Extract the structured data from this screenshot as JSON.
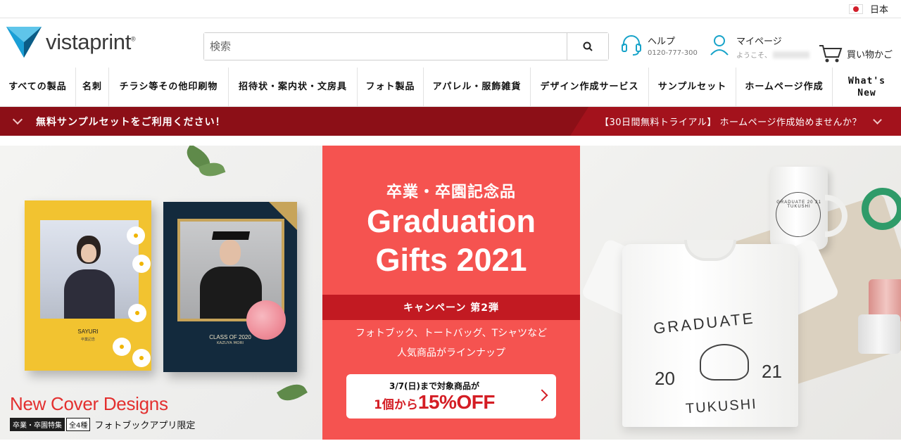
{
  "topbar": {
    "region": "日本"
  },
  "header": {
    "logo_text": "vistaprint",
    "logo_mark": "®",
    "search_placeholder": "検索",
    "help_label": "ヘルプ",
    "help_phone": "0120-777-300",
    "account_label": "マイページ",
    "account_greeting": "ようこそ、",
    "cart_label": "買い物かご"
  },
  "nav": {
    "items": [
      "すべての製品",
      "名刺",
      "チラシ等その他印刷物",
      "招待状・案内状・文房具",
      "フォト製品",
      "アパレル・服飾雑貨",
      "デザイン作成サービス",
      "サンプルセット",
      "ホームページ作成",
      "What's New"
    ]
  },
  "promo": {
    "left_text": "無料サンプルセットをご利用ください！",
    "right_text": "【30日間無料トライアル】 ホームページ作成始めませんか？"
  },
  "hero": {
    "left": {
      "book1_name": "SAYURI",
      "book1_sub": "卒業記念",
      "book2_name": "CLASS OF 2020",
      "book2_sub": "KAZUYA MORI",
      "headline": "New Cover Designs",
      "tag1": "卒業・卒園特集",
      "tag2": "全4種",
      "tagline": "フォトブックアプリ限定"
    },
    "mid": {
      "jp_title": "卒業・卒園記念品",
      "en_title_1": "Graduation",
      "en_title_2": "Gifts 2021",
      "campaign": "キャンペーン 第2弾",
      "desc_1": "フォトブック、トートバッグ、Tシャツなど",
      "desc_2": "人気商品がラインナップ",
      "cta_line1": "3/7(日)まで対象商品が",
      "cta_line2_a": "1個から",
      "cta_line2_b": "15%OFF"
    },
    "right": {
      "mug_text": "GRADUATE 20 21 TUKUSHI",
      "shirt_grad": "GRADUATE",
      "shirt_y1": "20",
      "shirt_y2": "21",
      "shirt_name": "TUKUSHI"
    }
  },
  "colors": {
    "brand_red": "#8c0f17",
    "hero_red": "#f55350",
    "campaign_red": "#c21a22",
    "logo_blue": "#0f7fb0"
  }
}
